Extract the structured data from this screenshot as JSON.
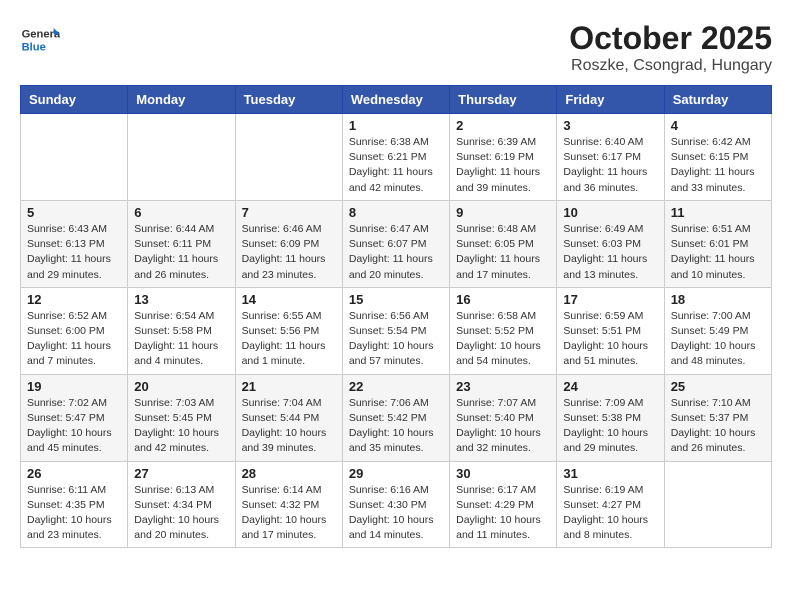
{
  "header": {
    "logo_general": "General",
    "logo_blue": "Blue",
    "month_title": "October 2025",
    "location": "Roszke, Csongrad, Hungary"
  },
  "days_of_week": [
    "Sunday",
    "Monday",
    "Tuesday",
    "Wednesday",
    "Thursday",
    "Friday",
    "Saturday"
  ],
  "weeks": [
    [
      {
        "day": "",
        "info": ""
      },
      {
        "day": "",
        "info": ""
      },
      {
        "day": "",
        "info": ""
      },
      {
        "day": "1",
        "info": "Sunrise: 6:38 AM\nSunset: 6:21 PM\nDaylight: 11 hours\nand 42 minutes."
      },
      {
        "day": "2",
        "info": "Sunrise: 6:39 AM\nSunset: 6:19 PM\nDaylight: 11 hours\nand 39 minutes."
      },
      {
        "day": "3",
        "info": "Sunrise: 6:40 AM\nSunset: 6:17 PM\nDaylight: 11 hours\nand 36 minutes."
      },
      {
        "day": "4",
        "info": "Sunrise: 6:42 AM\nSunset: 6:15 PM\nDaylight: 11 hours\nand 33 minutes."
      }
    ],
    [
      {
        "day": "5",
        "info": "Sunrise: 6:43 AM\nSunset: 6:13 PM\nDaylight: 11 hours\nand 29 minutes."
      },
      {
        "day": "6",
        "info": "Sunrise: 6:44 AM\nSunset: 6:11 PM\nDaylight: 11 hours\nand 26 minutes."
      },
      {
        "day": "7",
        "info": "Sunrise: 6:46 AM\nSunset: 6:09 PM\nDaylight: 11 hours\nand 23 minutes."
      },
      {
        "day": "8",
        "info": "Sunrise: 6:47 AM\nSunset: 6:07 PM\nDaylight: 11 hours\nand 20 minutes."
      },
      {
        "day": "9",
        "info": "Sunrise: 6:48 AM\nSunset: 6:05 PM\nDaylight: 11 hours\nand 17 minutes."
      },
      {
        "day": "10",
        "info": "Sunrise: 6:49 AM\nSunset: 6:03 PM\nDaylight: 11 hours\nand 13 minutes."
      },
      {
        "day": "11",
        "info": "Sunrise: 6:51 AM\nSunset: 6:01 PM\nDaylight: 11 hours\nand 10 minutes."
      }
    ],
    [
      {
        "day": "12",
        "info": "Sunrise: 6:52 AM\nSunset: 6:00 PM\nDaylight: 11 hours\nand 7 minutes."
      },
      {
        "day": "13",
        "info": "Sunrise: 6:54 AM\nSunset: 5:58 PM\nDaylight: 11 hours\nand 4 minutes."
      },
      {
        "day": "14",
        "info": "Sunrise: 6:55 AM\nSunset: 5:56 PM\nDaylight: 11 hours\nand 1 minute."
      },
      {
        "day": "15",
        "info": "Sunrise: 6:56 AM\nSunset: 5:54 PM\nDaylight: 10 hours\nand 57 minutes."
      },
      {
        "day": "16",
        "info": "Sunrise: 6:58 AM\nSunset: 5:52 PM\nDaylight: 10 hours\nand 54 minutes."
      },
      {
        "day": "17",
        "info": "Sunrise: 6:59 AM\nSunset: 5:51 PM\nDaylight: 10 hours\nand 51 minutes."
      },
      {
        "day": "18",
        "info": "Sunrise: 7:00 AM\nSunset: 5:49 PM\nDaylight: 10 hours\nand 48 minutes."
      }
    ],
    [
      {
        "day": "19",
        "info": "Sunrise: 7:02 AM\nSunset: 5:47 PM\nDaylight: 10 hours\nand 45 minutes."
      },
      {
        "day": "20",
        "info": "Sunrise: 7:03 AM\nSunset: 5:45 PM\nDaylight: 10 hours\nand 42 minutes."
      },
      {
        "day": "21",
        "info": "Sunrise: 7:04 AM\nSunset: 5:44 PM\nDaylight: 10 hours\nand 39 minutes."
      },
      {
        "day": "22",
        "info": "Sunrise: 7:06 AM\nSunset: 5:42 PM\nDaylight: 10 hours\nand 35 minutes."
      },
      {
        "day": "23",
        "info": "Sunrise: 7:07 AM\nSunset: 5:40 PM\nDaylight: 10 hours\nand 32 minutes."
      },
      {
        "day": "24",
        "info": "Sunrise: 7:09 AM\nSunset: 5:38 PM\nDaylight: 10 hours\nand 29 minutes."
      },
      {
        "day": "25",
        "info": "Sunrise: 7:10 AM\nSunset: 5:37 PM\nDaylight: 10 hours\nand 26 minutes."
      }
    ],
    [
      {
        "day": "26",
        "info": "Sunrise: 6:11 AM\nSunset: 4:35 PM\nDaylight: 10 hours\nand 23 minutes."
      },
      {
        "day": "27",
        "info": "Sunrise: 6:13 AM\nSunset: 4:34 PM\nDaylight: 10 hours\nand 20 minutes."
      },
      {
        "day": "28",
        "info": "Sunrise: 6:14 AM\nSunset: 4:32 PM\nDaylight: 10 hours\nand 17 minutes."
      },
      {
        "day": "29",
        "info": "Sunrise: 6:16 AM\nSunset: 4:30 PM\nDaylight: 10 hours\nand 14 minutes."
      },
      {
        "day": "30",
        "info": "Sunrise: 6:17 AM\nSunset: 4:29 PM\nDaylight: 10 hours\nand 11 minutes."
      },
      {
        "day": "31",
        "info": "Sunrise: 6:19 AM\nSunset: 4:27 PM\nDaylight: 10 hours\nand 8 minutes."
      },
      {
        "day": "",
        "info": ""
      }
    ]
  ]
}
